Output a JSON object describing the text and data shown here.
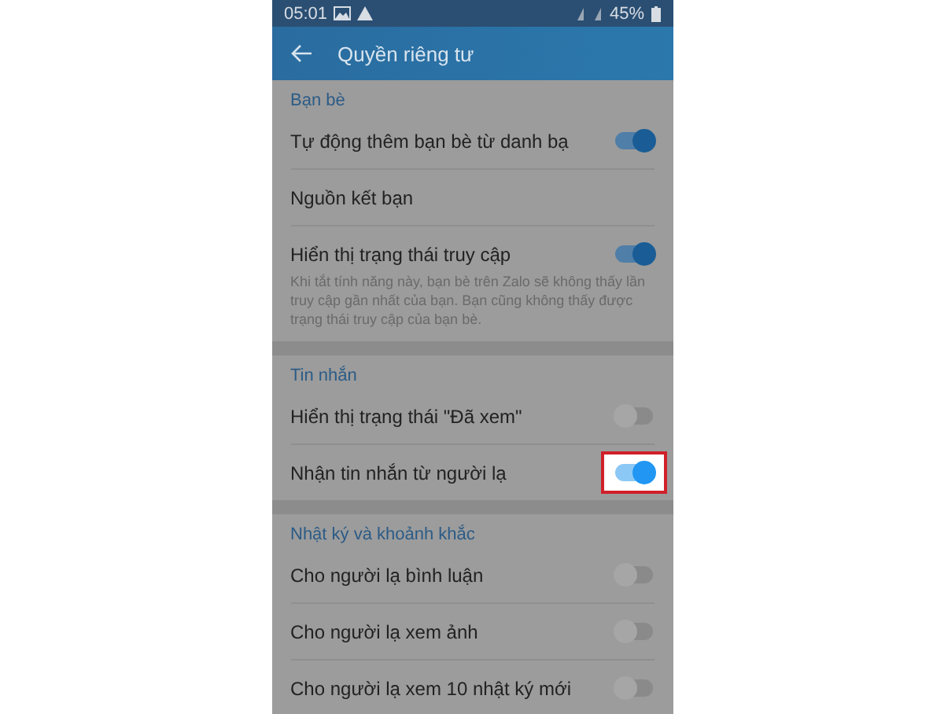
{
  "status_bar": {
    "time": "05:01",
    "battery": "45%"
  },
  "header": {
    "title": "Quyền riêng tư"
  },
  "sections": [
    {
      "title": "Bạn bè",
      "rows": [
        {
          "kind": "toggle",
          "label": "Tự động thêm bạn bè từ danh bạ",
          "on": true,
          "highlighted": false
        },
        {
          "kind": "link",
          "label": "Nguồn kết bạn"
        },
        {
          "kind": "toggle",
          "label": "Hiển thị trạng thái truy cập",
          "on": true,
          "highlighted": false,
          "description": "Khi tắt tính năng này, bạn bè trên Zalo sẽ không thấy lần truy cập gần nhất của bạn. Bạn cũng không thấy được trạng thái truy cập của bạn bè."
        }
      ]
    },
    {
      "title": "Tin nhắn",
      "rows": [
        {
          "kind": "toggle",
          "label": "Hiển thị trạng thái \"Đã xem\"",
          "on": false,
          "highlighted": false
        },
        {
          "kind": "toggle",
          "label": "Nhận tin nhắn từ người lạ",
          "on": true,
          "highlighted": true
        }
      ]
    },
    {
      "title": "Nhật ký và khoảnh khắc",
      "rows": [
        {
          "kind": "toggle",
          "label": "Cho người lạ bình luận",
          "on": false,
          "highlighted": false
        },
        {
          "kind": "toggle",
          "label": "Cho người lạ xem ảnh",
          "on": false,
          "highlighted": false
        },
        {
          "kind": "toggle",
          "label": "Cho người lạ xem 10 nhật ký mới",
          "on": false,
          "highlighted": false
        }
      ]
    }
  ]
}
